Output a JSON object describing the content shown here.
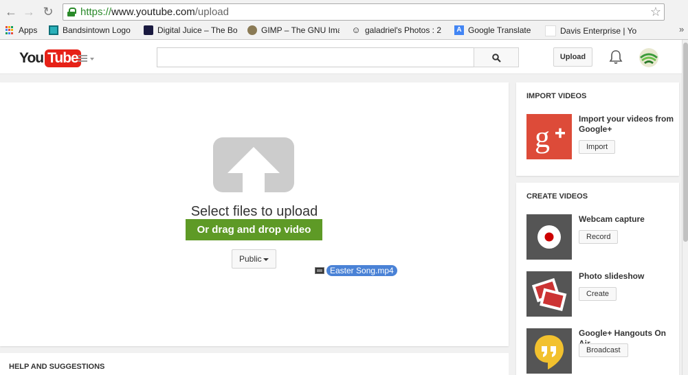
{
  "browser": {
    "url_scheme": "https://",
    "url_host": "www.youtube.com",
    "url_path": "/upload",
    "bookmarks": [
      {
        "label": "Apps",
        "icon": "apps-grid-icon"
      },
      {
        "label": "Bandsintown Logo",
        "icon": "bandsintown-icon"
      },
      {
        "label": "Digital Juice – The Bo",
        "icon": "digital-juice-icon"
      },
      {
        "label": "GIMP – The GNU Ima",
        "icon": "gimp-icon"
      },
      {
        "label": "galadriel's Photos : 2",
        "icon": "smile-icon"
      },
      {
        "label": "Google Translate",
        "icon": "google-translate-icon"
      },
      {
        "label": "Davis Enterprise | Yo",
        "icon": "blank-page-icon"
      }
    ]
  },
  "header": {
    "logo_you": "You",
    "logo_tube": "Tube",
    "search_placeholder": "",
    "upload_label": "Upload"
  },
  "upload": {
    "title": "Select files to upload",
    "drag_text": "Or drag and drop video files",
    "privacy_value": "Public",
    "dragged_file": "Easter Song.mp4"
  },
  "help": {
    "title": "HELP AND SUGGESTIONS"
  },
  "import": {
    "title": "IMPORT VIDEOS",
    "item_title": "Import your videos from Google+",
    "button": "Import",
    "colors": {
      "tile": "#dd4b39"
    }
  },
  "create": {
    "title": "CREATE VIDEOS",
    "items": [
      {
        "title": "Webcam capture",
        "button": "Record",
        "icon": "record-icon"
      },
      {
        "title": "Photo slideshow",
        "button": "Create",
        "icon": "photos-icon"
      },
      {
        "title": "Google+ Hangouts On Air",
        "button": "Broadcast",
        "icon": "hangouts-icon"
      }
    ]
  },
  "colors": {
    "brand_red": "#e62117",
    "drag_green": "#5e9a26",
    "file_blue": "#4a82d6"
  }
}
